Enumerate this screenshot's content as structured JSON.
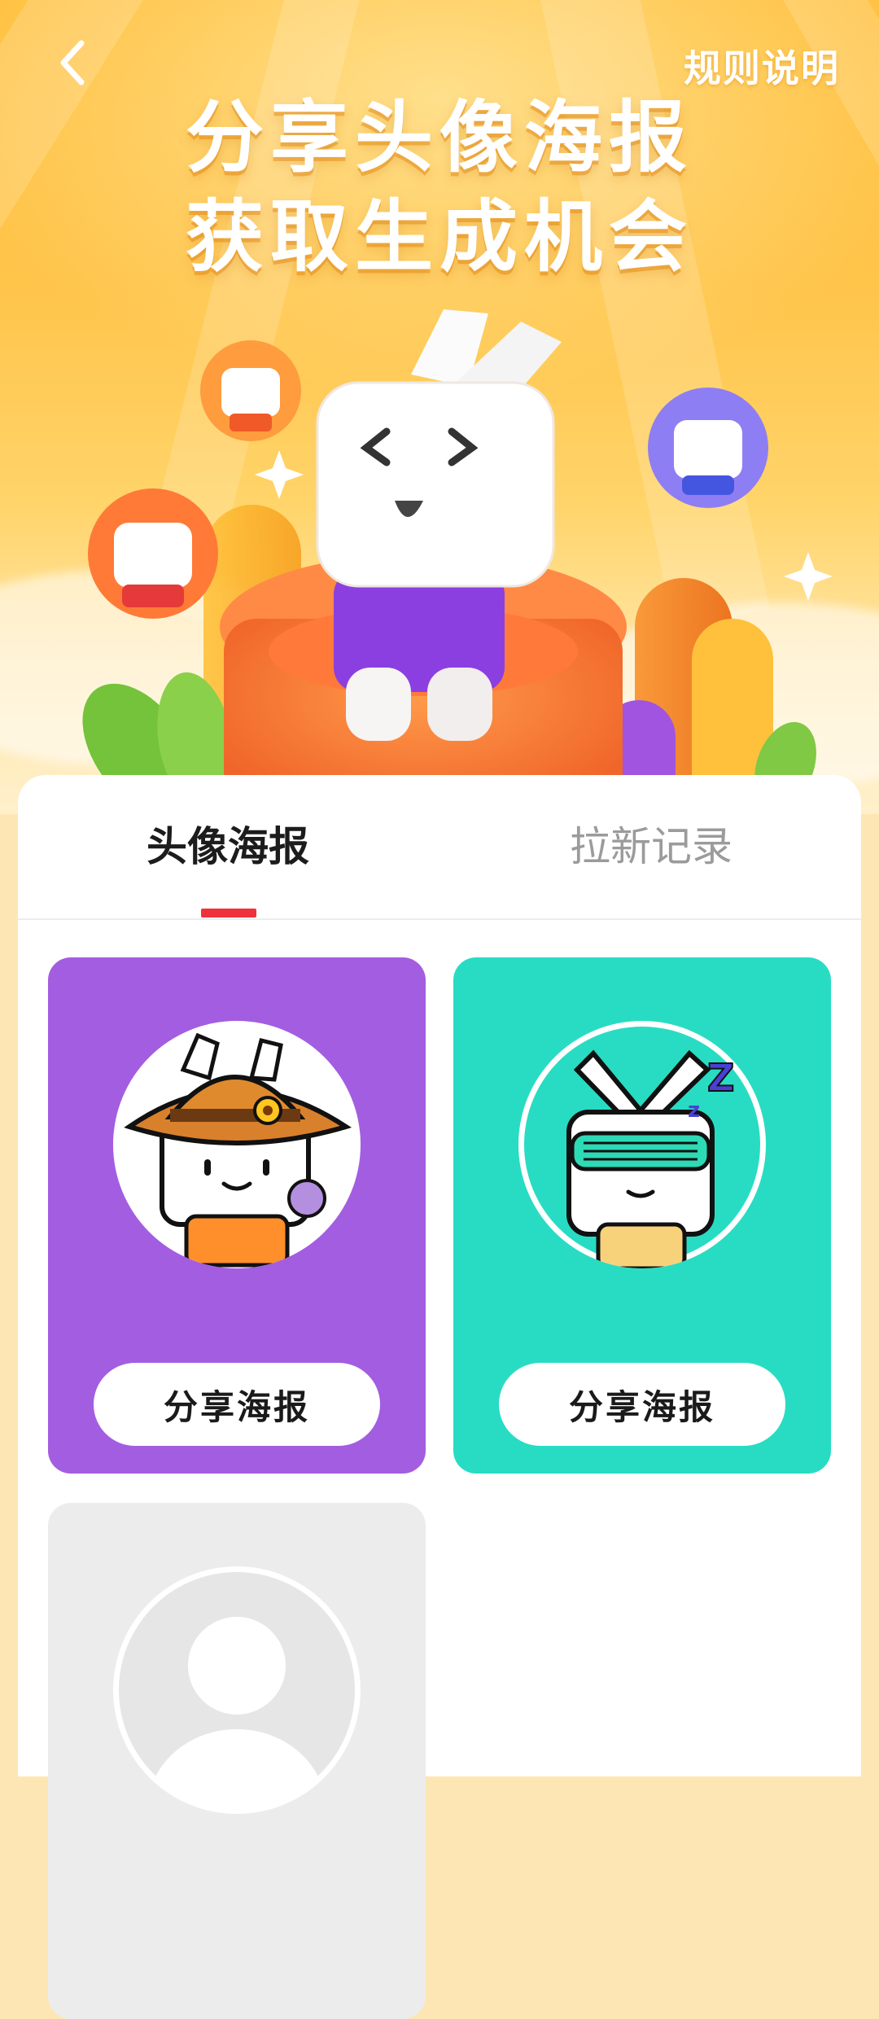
{
  "header": {
    "back_icon": "chevron-left-icon",
    "rules_label": "规则说明",
    "title_line1": "分享头像海报",
    "title_line2": "获取生成机会"
  },
  "tabs": [
    {
      "label": "头像海报",
      "active": true
    },
    {
      "label": "拉新记录",
      "active": false
    }
  ],
  "posters": [
    {
      "bg_color": "#a35de1",
      "avatar": "cowboy-hat-bunny-avatar",
      "share_label": "分享海报"
    },
    {
      "bg_color": "#28dcc3",
      "avatar": "sunglasses-bunny-avatar",
      "share_label": "分享海报"
    },
    {
      "bg_color": "#ececec",
      "avatar": "placeholder-user-avatar"
    }
  ],
  "colors": {
    "accent": "#f0313c",
    "hero_orange": "#ffbf3c"
  }
}
